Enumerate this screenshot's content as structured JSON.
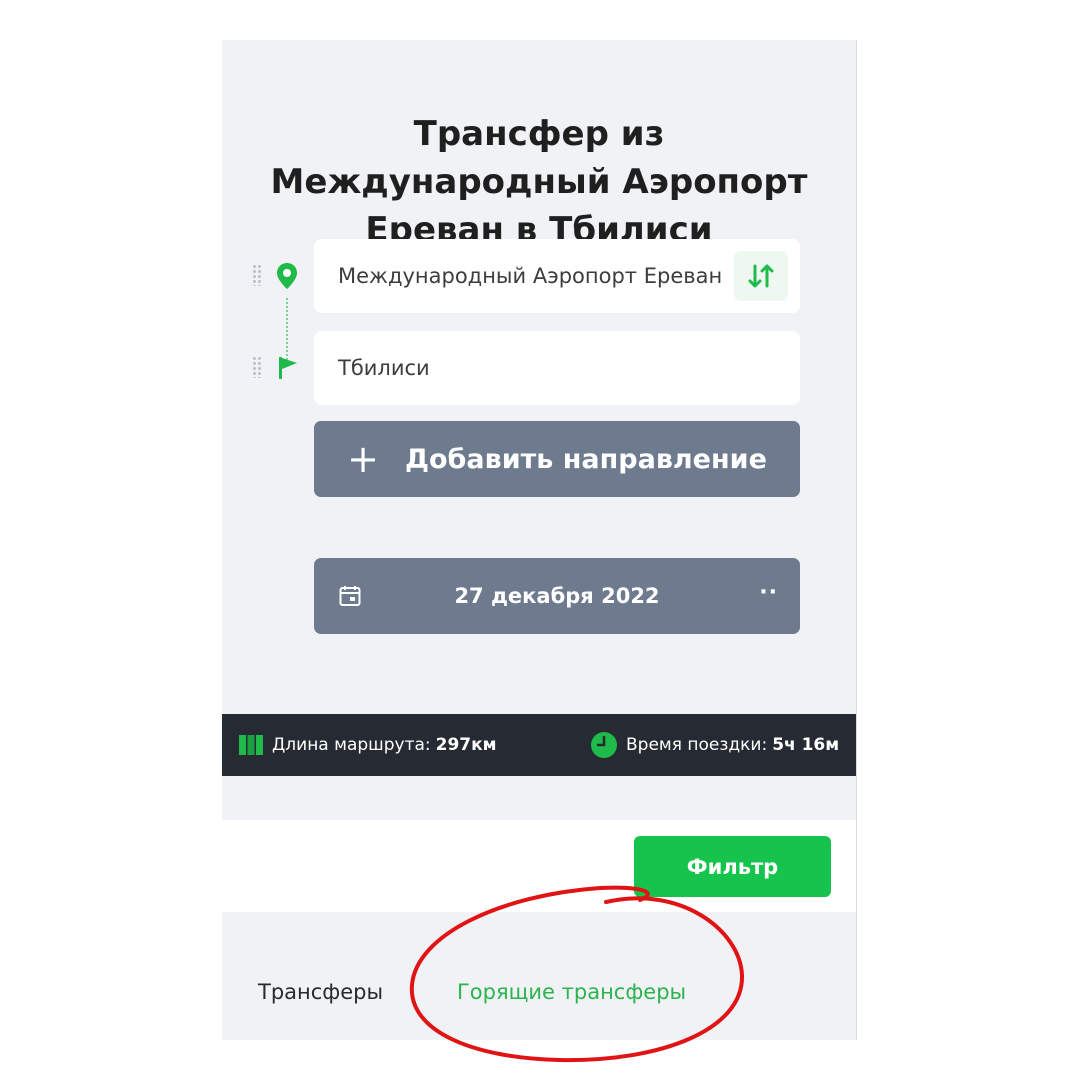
{
  "title": {
    "line1": "Трансфер из",
    "line2": "Международный Аэропорт",
    "line3": "Ереван в Тбилиси"
  },
  "route": {
    "from_value": "Международный Аэропорт Ереван",
    "to_value": "Тбилиси"
  },
  "add_direction_label": "Добавить направление",
  "add_direction_plus": "+",
  "date": {
    "value": "27 декабря 2022",
    "more": "··"
  },
  "info_bar": {
    "length_label": "Длина маршрута:",
    "length_value": "297км",
    "time_label": "Время поездки:",
    "time_value": "5ч 16м"
  },
  "filter_label": "Фильтр",
  "tabs": [
    {
      "label": "Трансферы",
      "active": false
    },
    {
      "label": "Горящие трансферы",
      "active": true
    }
  ],
  "icons": {
    "origin": "map-pin-icon",
    "destination": "flag-icon",
    "swap": "swap-arrows-icon",
    "date": "calendar-icon",
    "length": "map-icon",
    "time": "clock-icon"
  },
  "colors": {
    "accent_green": "#16c44d",
    "button_gray": "#6e7a8d",
    "info_bar_bg": "#262b33",
    "annotation_red": "#e01414"
  }
}
